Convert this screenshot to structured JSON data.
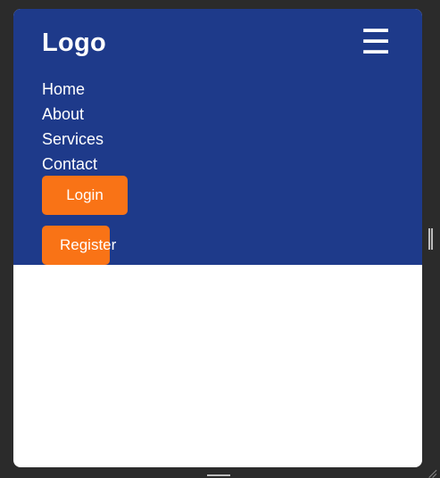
{
  "header": {
    "logo_text": "Logo",
    "menu_icon": "hamburger-icon",
    "menu_glyph": "☰"
  },
  "nav": {
    "items": [
      {
        "label": "Home"
      },
      {
        "label": "About"
      },
      {
        "label": "Services"
      },
      {
        "label": "Contact"
      }
    ]
  },
  "actions": {
    "login_label": "Login",
    "register_label": "Register"
  },
  "colors": {
    "navbar_background": "#1e3a8a",
    "button_accent": "#f97316",
    "text": "#ffffff",
    "page_background": "#ffffff"
  }
}
